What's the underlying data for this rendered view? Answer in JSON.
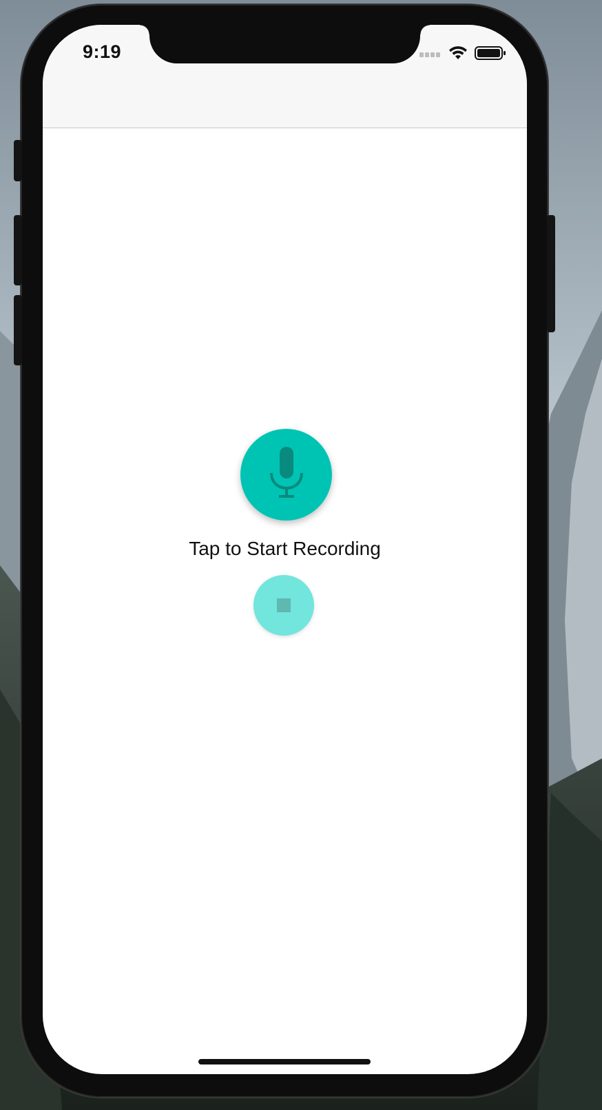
{
  "status_bar": {
    "time": "9:19"
  },
  "main": {
    "prompt": "Tap to Start Recording"
  },
  "colors": {
    "accent": "#00c4b3",
    "accent_light": "#72e5dc",
    "icon_dark": "#0a8a7e"
  },
  "icons": {
    "record": "microphone-icon",
    "stop": "stop-icon"
  }
}
